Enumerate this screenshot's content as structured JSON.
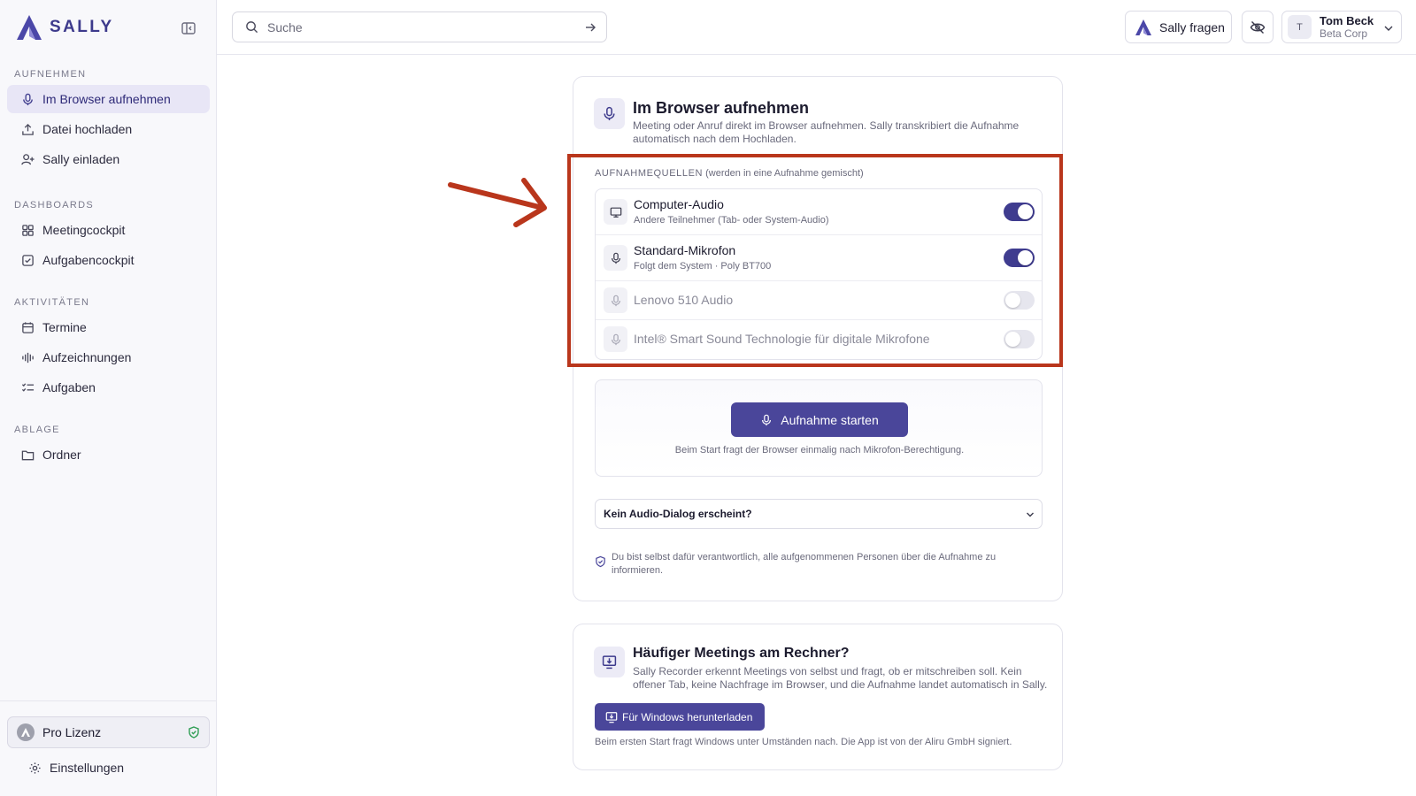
{
  "brand": {
    "name": "SALLY",
    "color": "#3d3a8c"
  },
  "sidebar": {
    "sections": [
      {
        "title": "AUFNEHMEN",
        "items": [
          {
            "label": "Im Browser aufnehmen",
            "icon": "mic-icon",
            "active": true
          },
          {
            "label": "Datei hochladen",
            "icon": "upload-icon"
          },
          {
            "label": "Sally einladen",
            "icon": "user-plus-icon"
          }
        ]
      },
      {
        "title": "DASHBOARDS",
        "items": [
          {
            "label": "Meetingcockpit",
            "icon": "grid-icon"
          },
          {
            "label": "Aufgabencockpit",
            "icon": "check-square-icon"
          }
        ]
      },
      {
        "title": "AKTIVITÄTEN",
        "items": [
          {
            "label": "Termine",
            "icon": "calendar-icon"
          },
          {
            "label": "Aufzeichnungen",
            "icon": "waveform-icon"
          },
          {
            "label": "Aufgaben",
            "icon": "list-check-icon"
          }
        ]
      },
      {
        "title": "ABLAGE",
        "items": [
          {
            "label": "Ordner",
            "icon": "folder-icon"
          }
        ]
      }
    ],
    "license": {
      "label": "Pro Lizenz",
      "icon": "shield-check-icon"
    },
    "settings": {
      "label": "Einstellungen",
      "icon": "gear-icon"
    }
  },
  "topbar": {
    "search": {
      "placeholder": "Suche",
      "value": ""
    },
    "ask": {
      "label": "Sally fragen"
    },
    "user": {
      "initial": "T",
      "name": "Tom Beck",
      "org": "Beta Corp"
    }
  },
  "recorder": {
    "title": "Im Browser aufnehmen",
    "description": "Meeting oder Anruf direkt im Browser aufnehmen. Sally transkribiert die Aufnahme automatisch nach dem Hochladen.",
    "sources_title": "AUFNAHMEQUELLEN",
    "sources_note": "(werden in eine Aufnahme gemischt)",
    "sources": [
      {
        "name": "Computer-Audio",
        "sub": "Andere Teilnehmer (Tab- oder System-Audio)",
        "enabled": true,
        "icon": "monitor-icon"
      },
      {
        "name": "Standard-Mikrofon",
        "sub": "Folgt dem System · Poly BT700",
        "enabled": true,
        "icon": "mic-icon"
      },
      {
        "name": "Lenovo 510 Audio",
        "sub": "",
        "enabled": false,
        "icon": "mic-icon"
      },
      {
        "name": "Intel® Smart Sound Technologie für digitale Mikrofone",
        "sub": "",
        "enabled": false,
        "icon": "mic-icon"
      }
    ],
    "start_label": "Aufnahme starten",
    "start_hint": "Beim Start fragt der Browser einmalig nach Mikrofon-Berechtigung.",
    "dialog_question": "Kein Audio-Dialog erscheint?",
    "consent": "Du bist selbst dafür verantwortlich, alle aufgenommenen Personen über die Aufnahme zu informieren."
  },
  "desktop_app": {
    "title": "Häufiger Meetings am Rechner?",
    "description": "Sally Recorder erkennt Meetings von selbst und fragt, ob er mitschreiben soll. Kein offener Tab, keine Nachfrage im Browser, und die Aufnahme landet automatisch in Sally.",
    "download_label": "Für Windows herunterladen",
    "hint": "Beim ersten Start fragt Windows unter Umständen nach. Die App ist von der Aliru GmbH signiert."
  },
  "colors": {
    "accent": "#4a469a",
    "highlight": "#b9361c",
    "toggle_on": "#3f3c8f"
  }
}
